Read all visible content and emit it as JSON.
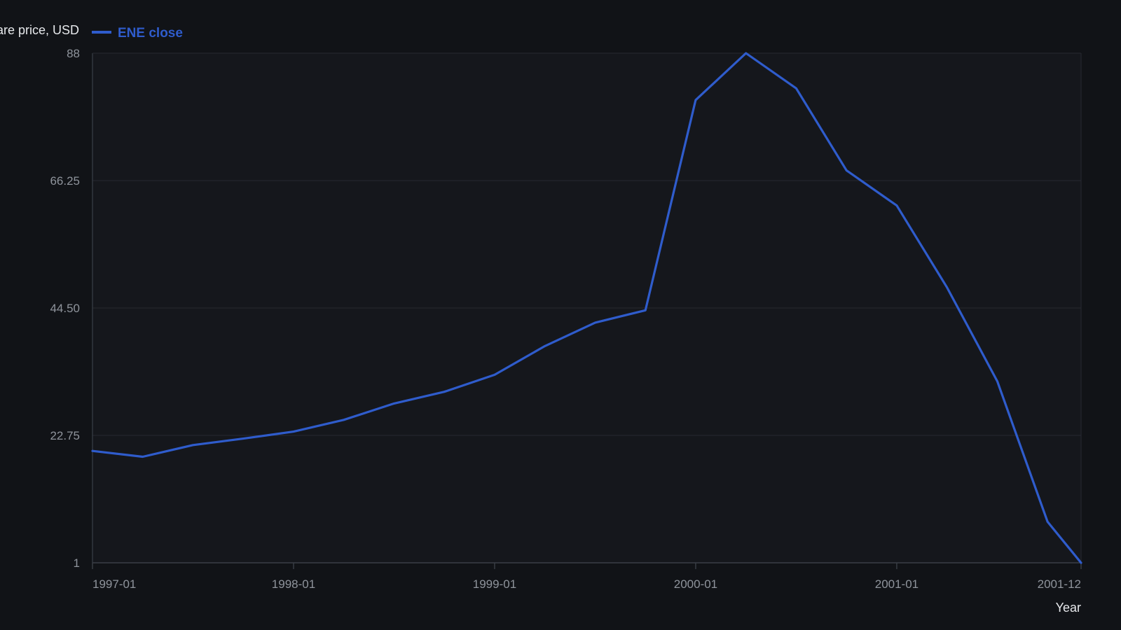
{
  "colors": {
    "background": "#111317",
    "plot_area": "#15171c",
    "grid": "#262a31",
    "axis": "#3a3f47",
    "tick_text": "#8f949c",
    "title_text": "#e7e9ec",
    "series": "#2f5ccc"
  },
  "chart_data": {
    "type": "line",
    "xlabel": "Year",
    "ylabel": "Share price, USD",
    "ylim": [
      1,
      88
    ],
    "y_ticks": [
      1,
      22.75,
      44.5,
      66.25,
      88
    ],
    "y_tick_labels": [
      "1",
      "22.75",
      "44.50",
      "66.25",
      "88"
    ],
    "x_tick_labels": [
      "1997-01",
      "1998-01",
      "1999-01",
      "2000-01",
      "2001-01",
      "2001-12"
    ],
    "x_tick_dates": [
      "1997-01",
      "1998-01",
      "1999-01",
      "2000-01",
      "2001-01",
      "2001-12"
    ],
    "grid": true,
    "legend_position": "top-left",
    "series": [
      {
        "name": "ENE close",
        "color": "#2f5ccc",
        "points": [
          {
            "x": "1997-01",
            "y": 20.1
          },
          {
            "x": "1997-04",
            "y": 19.1
          },
          {
            "x": "1997-07",
            "y": 21.1
          },
          {
            "x": "1997-10",
            "y": 22.2
          },
          {
            "x": "1998-01",
            "y": 23.4
          },
          {
            "x": "1998-04",
            "y": 25.4
          },
          {
            "x": "1998-07",
            "y": 28.2
          },
          {
            "x": "1998-10",
            "y": 30.2
          },
          {
            "x": "1999-01",
            "y": 33.1
          },
          {
            "x": "1999-04",
            "y": 38.0
          },
          {
            "x": "1999-07",
            "y": 42.0
          },
          {
            "x": "1999-10",
            "y": 44.1
          },
          {
            "x": "2000-01",
            "y": 80.0
          },
          {
            "x": "2000-04",
            "y": 88.0
          },
          {
            "x": "2000-07",
            "y": 82.0
          },
          {
            "x": "2000-10",
            "y": 68.0
          },
          {
            "x": "2001-01",
            "y": 62.0
          },
          {
            "x": "2001-04",
            "y": 48.0
          },
          {
            "x": "2001-07",
            "y": 32.0
          },
          {
            "x": "2001-10",
            "y": 8.0
          },
          {
            "x": "2001-12",
            "y": 1.0
          }
        ]
      }
    ]
  }
}
